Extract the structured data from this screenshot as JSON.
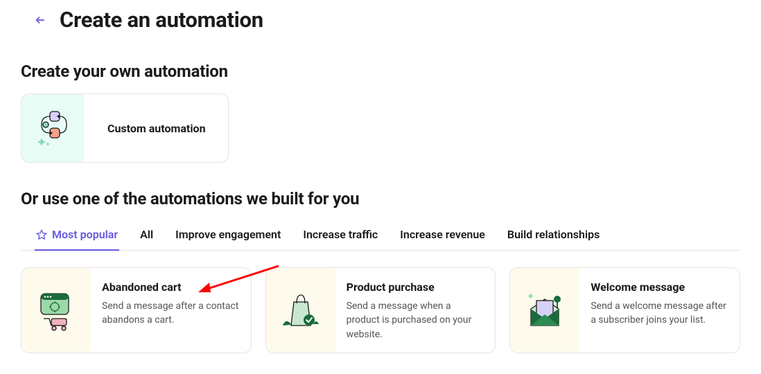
{
  "header": {
    "title": "Create an automation"
  },
  "custom": {
    "section_title": "Create your own automation",
    "card_label": "Custom automation"
  },
  "templates": {
    "section_title": "Or use one of the automations we built for you",
    "tabs": [
      {
        "label": "Most popular",
        "active": true,
        "icon": "star"
      },
      {
        "label": "All",
        "active": false
      },
      {
        "label": "Improve engagement",
        "active": false
      },
      {
        "label": "Increase traffic",
        "active": false
      },
      {
        "label": "Increase revenue",
        "active": false
      },
      {
        "label": "Build relationships",
        "active": false
      }
    ],
    "cards": [
      {
        "title": "Abandoned cart",
        "desc": "Send a message after a contact abandons a cart."
      },
      {
        "title": "Product purchase",
        "desc": "Send a message when a product is purchased on your website."
      },
      {
        "title": "Welcome message",
        "desc": "Send a welcome message after a subscriber joins your list."
      }
    ]
  },
  "annotation": {
    "arrow_target": "Abandoned cart"
  }
}
